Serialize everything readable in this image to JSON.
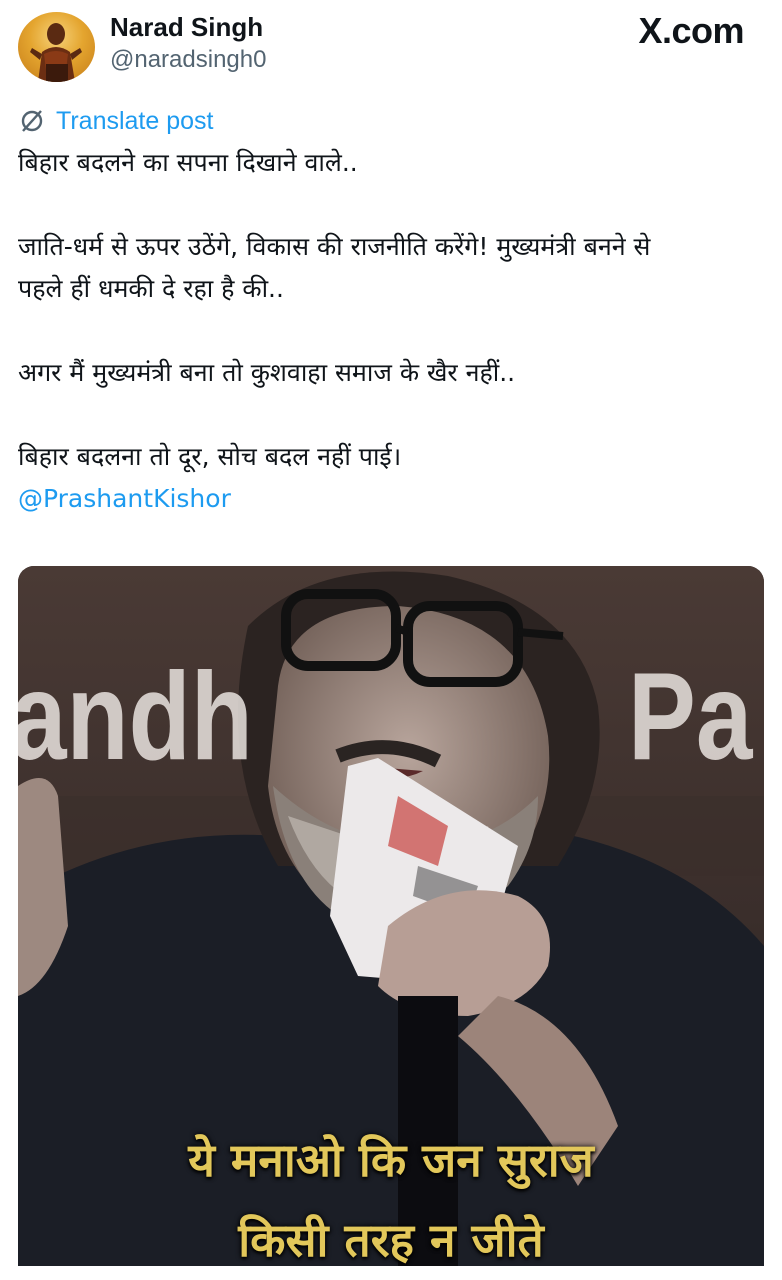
{
  "author": {
    "name": "Narad Singh",
    "handle": "@naradsingh0",
    "avatar_icon": "profile-avatar"
  },
  "brand": "X.com",
  "translate": {
    "icon": "translate-icon",
    "label": "Translate post"
  },
  "post": {
    "line1": "बिहार बदलने का सपना दिखाने वाले..",
    "line2a": "जाति-धर्म से ऊपर उठेंगे, विकास की राजनीति करेंगे! मुख्यमंत्री बनने से",
    "line2b": "पहले हीं धमकी दे रहा है की..",
    "line3": "अगर मैं मुख्यमंत्री बना तो कुशवाहा समाज के खैर नहीं..",
    "line4": "बिहार बदलना तो दूर, सोच बदल नहीं पाई।",
    "mention": "@PrashantKishor"
  },
  "media": {
    "bg_text_left": "andh",
    "bg_text_right": "Pa",
    "caption_line1": "ये मनाओ कि जन सुराज",
    "caption_line2": "किसी तरह न जीते",
    "caption_color": "#e2c75a"
  },
  "colors": {
    "link": "#1d9bf0",
    "text": "#0f1419",
    "muted": "#536471"
  }
}
